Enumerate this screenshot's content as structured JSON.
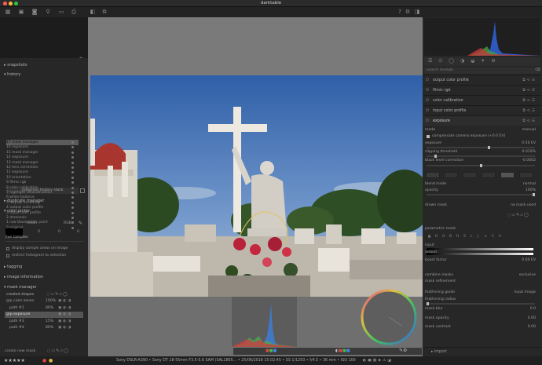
{
  "app": {
    "title": "darktable"
  },
  "left": {
    "sections": {
      "snapshots": "snapshots",
      "history": "history",
      "duplicate": "duplicate manager",
      "color_picker": "color picker",
      "tagging": "tagging",
      "image_info": "image information",
      "mask_manager": "mask manager"
    },
    "history_items": [
      "17 mask manager",
      "16 exposure",
      "15 mask manager",
      "14 exposure",
      "13 mask manager",
      "12 lens correction",
      "11 exposure",
      "10 orientation",
      "9 filmic rgb",
      "8 color calibration",
      "7 highlight reconstruction",
      "6 white balance",
      "5 display encoding",
      "4 output color profile",
      "3 input color profile",
      "2 demosaic",
      "1 raw black/white point",
      "0 original"
    ],
    "compress_label": "compress history stack",
    "picker": {
      "mode": "mean",
      "color_space": "RGB",
      "values": [
        "0",
        "0",
        "0"
      ],
      "live_samples": "live samples",
      "display_samples": "display sample areas on image",
      "restrict": "restrict histogram to selection"
    },
    "masks": {
      "created_shapes": "created shapes",
      "rows": [
        {
          "name": "grp color zones",
          "opacity": "100%"
        },
        {
          "name": "path #1",
          "opacity": "80%"
        },
        {
          "name": "grp exposure",
          "opacity": ""
        },
        {
          "name": "path #3",
          "opacity": "15%"
        },
        {
          "name": "path #4",
          "opacity": "80%"
        }
      ],
      "create_new": "create new mask"
    }
  },
  "right": {
    "search_placeholder": "search module",
    "modules": [
      "output color profile",
      "filmic rgb",
      "color calibration",
      "input color profile",
      "exposure"
    ],
    "exposure": {
      "mode_label": "mode",
      "mode_value": "manual",
      "compensate": "compensate camera exposure (+0.0 EV)",
      "exposure_label": "exposure",
      "exposure_value": "0.50 EV",
      "clip_label": "clipping threshold",
      "clip_value": "0.010%",
      "black_label": "black level correction",
      "black_value": "-0.0002"
    },
    "blend": {
      "blend_mode_label": "blend mode",
      "blend_mode_value": "normal",
      "opacity_label": "opacity",
      "opacity_value": "100%",
      "drawn_mask_label": "drawn mask",
      "drawn_mask_value": "no mask used",
      "parametric_label": "parametric mask",
      "channels": [
        "g",
        "R",
        "G",
        "B",
        "H",
        "S",
        "L",
        "J",
        "z",
        "C",
        "h"
      ],
      "input_label": "input",
      "output_label": "output",
      "boost_label": "boost factor",
      "boost_value": "0.00 EV",
      "combine_label": "combine masks",
      "combine_value": "exclusive",
      "refine_label": "mask refinement",
      "feather_guide_label": "feathering guide",
      "feather_guide_value": "input image",
      "feather_radius_label": "feathering radius",
      "blur_label": "mask blur",
      "blur_value": "0.0",
      "mask_opacity_label": "mask opacity",
      "mask_opacity_value": "0.00",
      "mask_contrast_label": "mask contrast",
      "mask_contrast_value": "0.00"
    },
    "bottom_module": "import"
  },
  "status": {
    "rating": "★★★★★",
    "exif": "Sony DSLR-A390 • Sony DT 18-55mm F3.5-5.6 SAM (SAL1855... • 25/06/2018 15:02:45 • SS 1/1250 • f/4.5 • 36 mm • ISO 100"
  },
  "colors": {
    "accent": "#e0c35a",
    "panel": "#272727",
    "center": "#7a7a7a"
  }
}
